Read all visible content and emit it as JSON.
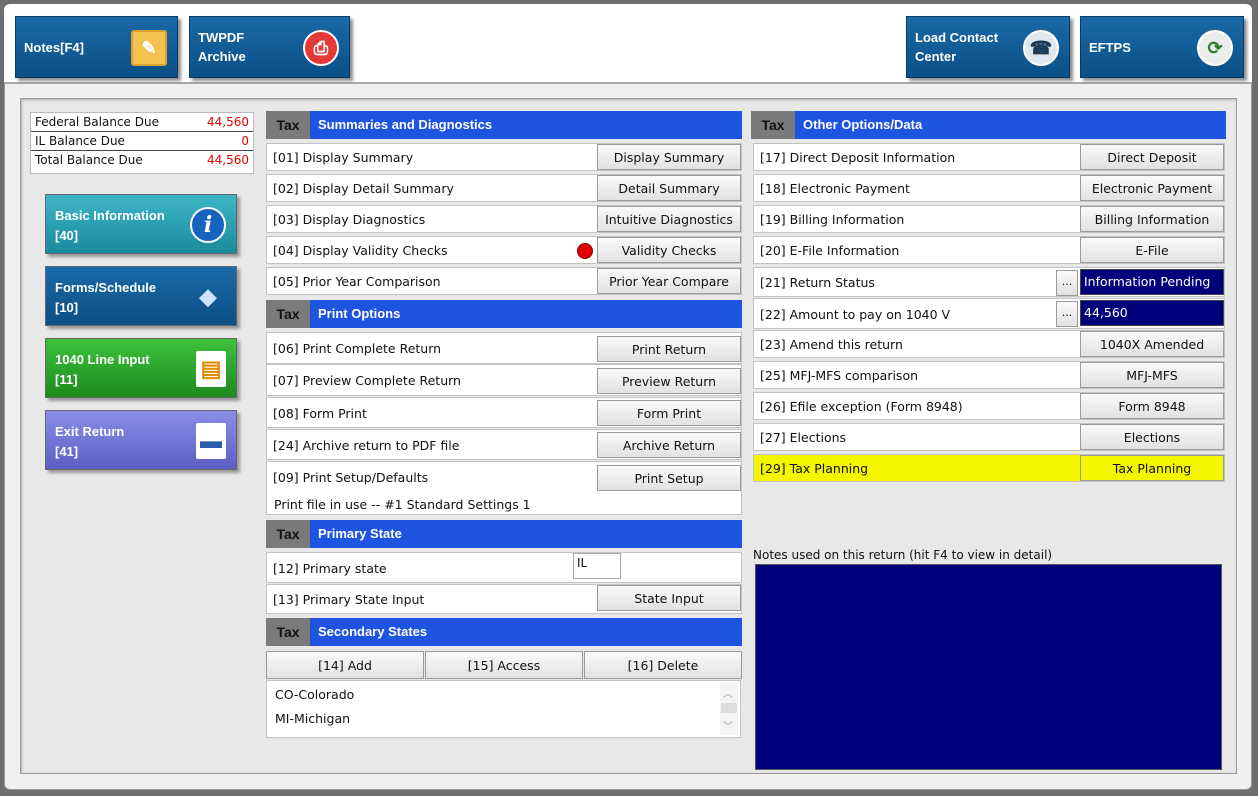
{
  "toolbar": {
    "notes": "Notes[F4]",
    "twpdf": "TWPDF\nArchive",
    "load_contact": "Load Contact\nCenter",
    "eftps": "EFTPS"
  },
  "balances": [
    {
      "label": "Federal Balance Due",
      "value": "44,560"
    },
    {
      "label": "IL Balance Due",
      "value": "0"
    },
    {
      "label": "Total Balance Due",
      "value": "44,560"
    }
  ],
  "side_buttons": [
    {
      "line1": "Basic Information",
      "line2": "[40]"
    },
    {
      "line1": "Forms/Schedule",
      "line2": "[10]"
    },
    {
      "line1": "1040 Line Input",
      "line2": "[11]"
    },
    {
      "line1": "Exit Return",
      "line2": "[41]"
    }
  ],
  "tag": "Tax",
  "summaries": {
    "title": "Summaries and Diagnostics",
    "rows": [
      {
        "label": "[01] Display Summary",
        "button": "Display Summary"
      },
      {
        "label": "[02] Display Detail Summary",
        "button": "Detail Summary"
      },
      {
        "label": "[03] Display Diagnostics",
        "button": "Intuitive Diagnostics"
      },
      {
        "label": "[04] Display Validity Checks",
        "button": "Validity Checks"
      },
      {
        "label": "[05] Prior Year Comparison",
        "button": "Prior Year Compare"
      }
    ]
  },
  "print": {
    "title": "Print Options",
    "rows": [
      {
        "label": "[06] Print Complete Return",
        "button": "Print Return"
      },
      {
        "label": "[07] Preview Complete Return",
        "button": "Preview Return"
      },
      {
        "label": "[08] Form Print",
        "button": "Form Print"
      },
      {
        "label": "[24] Archive return to PDF file",
        "button": "Archive Return"
      },
      {
        "label": "[09] Print Setup/Defaults",
        "button": "Print Setup"
      }
    ],
    "print_file": "Print file in use -- #1  Standard Settings 1"
  },
  "primary_state": {
    "title": "Primary State",
    "state_label": "[12] Primary state",
    "state_value": "IL",
    "input_label": "[13] Primary State Input",
    "input_button": "State Input"
  },
  "secondary_states": {
    "title": "Secondary States",
    "add": "[14] Add",
    "access": "[15] Access",
    "delete": "[16] Delete",
    "items": [
      "CO-Colorado",
      "MI-Michigan"
    ]
  },
  "other": {
    "title": "Other Options/Data",
    "rows": [
      {
        "label": "[17] Direct Deposit Information",
        "button": "Direct Deposit"
      },
      {
        "label": "[18] Electronic Payment",
        "button": "Electronic Payment"
      },
      {
        "label": "[19] Billing Information",
        "button": "Billing Information"
      },
      {
        "label": "[20] E-File Information",
        "button": "E-File"
      },
      {
        "label": "[21] Return Status",
        "value": "Information Pending"
      },
      {
        "label": "[22] Amount to pay on 1040 V",
        "value": "44,560"
      },
      {
        "label": "[23] Amend this return",
        "button": "1040X Amended"
      },
      {
        "label": "[25] MFJ-MFS comparison",
        "button": "MFJ-MFS"
      },
      {
        "label": "[26] Efile exception (Form 8948)",
        "button": "Form 8948"
      },
      {
        "label": "[27] Elections",
        "button": "Elections"
      },
      {
        "label": "[29] Tax Planning",
        "button": "Tax Planning"
      }
    ],
    "dots": "..."
  },
  "notes_label": "Notes used on this return (hit F4 to view in detail)",
  "colors": {
    "header_blue": "#1f54e0",
    "value_navy": "#00007a",
    "alert_red": "#e00000",
    "highlight_yellow": "#f5f500"
  }
}
